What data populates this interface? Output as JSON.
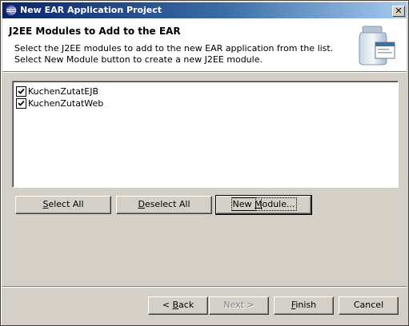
{
  "window": {
    "title": "New EAR Application Project",
    "close_label": "✕"
  },
  "banner": {
    "title": "J2EE Modules to Add to the EAR",
    "description_line1": "Select the J2EE modules to add to the new EAR application from the list.",
    "description_line2": "Select New Module button to create a new J2EE module."
  },
  "modules": [
    {
      "label": "KuchenZutatEJB",
      "checked": true
    },
    {
      "label": "KuchenZutatWeb",
      "checked": true
    }
  ],
  "actions": {
    "select_all_mnemonic": "S",
    "select_all_rest": "elect All",
    "deselect_all_mnemonic": "D",
    "deselect_all_rest": "eselect All",
    "new_module_pre": "New ",
    "new_module_mnemonic": "M",
    "new_module_rest": "odule..."
  },
  "footer": {
    "back_pre": "< ",
    "back_mnemonic": "B",
    "back_rest": "ack",
    "next_label": "Next >",
    "finish_mnemonic": "F",
    "finish_rest": "inish",
    "cancel_label": "Cancel"
  },
  "colors": {
    "titlebar_start": "#0a246a",
    "titlebar_end": "#a6caf0",
    "dialog_bg": "#d4d0c8"
  }
}
